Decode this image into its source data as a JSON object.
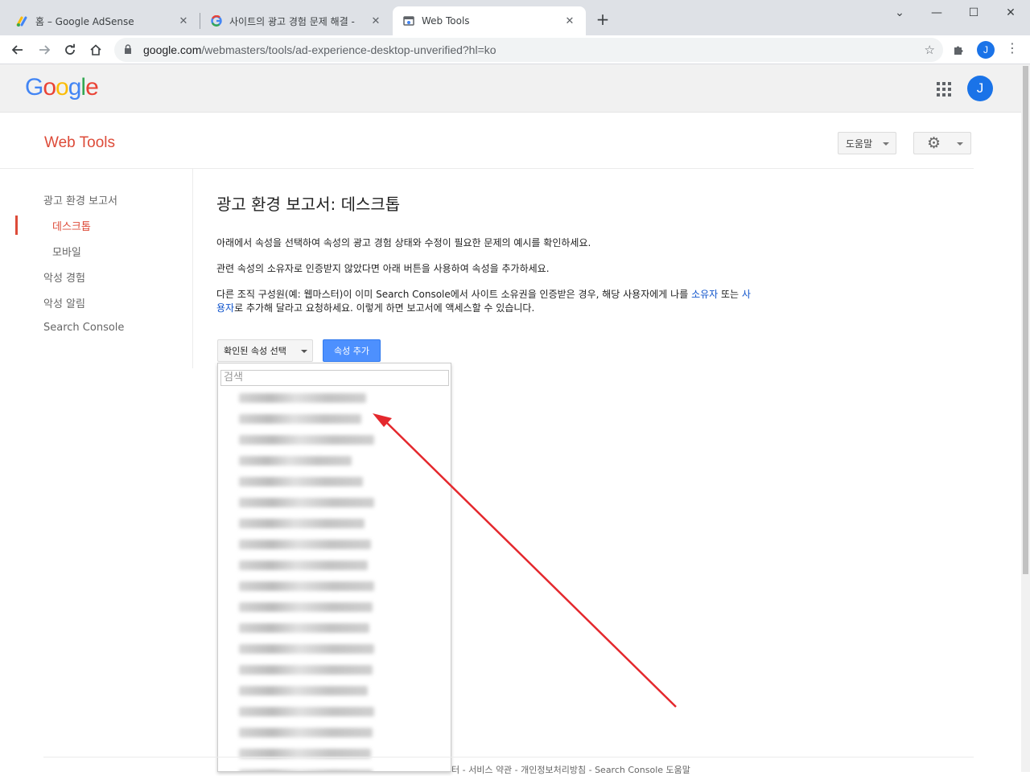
{
  "browser": {
    "tabs": [
      {
        "title": "홈 – Google AdSense",
        "favicon": "adsense-icon"
      },
      {
        "title": "사이트의 광고 경험 문제 해결 -",
        "favicon": "google-g-icon"
      },
      {
        "title": "Web Tools",
        "favicon": "webtools-icon",
        "active": true
      }
    ],
    "new_tab": "+",
    "url_host": "google.com",
    "url_path": "/webmasters/tools/ad-experience-desktop-unverified?hl=ko",
    "profile_initial": "J"
  },
  "header": {
    "logo_letters": [
      {
        "ch": "G",
        "color": "#4285f4"
      },
      {
        "ch": "o",
        "color": "#ea4335"
      },
      {
        "ch": "o",
        "color": "#fbbc05"
      },
      {
        "ch": "g",
        "color": "#4285f4"
      },
      {
        "ch": "l",
        "color": "#34a853"
      },
      {
        "ch": "e",
        "color": "#ea4335"
      }
    ],
    "avatar_initial": "J"
  },
  "webtools": {
    "title": "Web Tools",
    "help_label": "도움말"
  },
  "sidebar": {
    "items": [
      {
        "label": "광고 환경 보고서"
      },
      {
        "label": "데스크톱",
        "active": true
      },
      {
        "label": "모바일"
      },
      {
        "label": "악성 경험"
      },
      {
        "label": "악성 알림"
      },
      {
        "label": "Search Console"
      }
    ]
  },
  "main": {
    "title": "광고 환경 보고서: 데스크톱",
    "para1": "아래에서 속성을 선택하여 속성의 광고 경험 상태와 수정이 필요한 문제의 예시를 확인하세요.",
    "para2": "관련 속성의 소유자로 인증받지 않았다면 아래 버튼을 사용하여 속성을 추가하세요.",
    "para3_line1_a": "다른 조직 구성원(예: 웹마스터)이 이미 Search Console에서 사이트 소유권을 인증받은 경우, 해당 사용자에게 나를 ",
    "para3_link1": "소유자",
    "para3_line1_b": " 또는 ",
    "para3_link2a": "사",
    "para3_link2b": "용자",
    "para3_line2": "로 추가해 달라고 요청하세요. 이렇게 하면 보고서에 액세스할 수 있습니다.",
    "select_label": "확인된 속성 선택",
    "add_button": "속성 추가",
    "search_placeholder": "검색"
  },
  "footer": {
    "text": "터 - 서비스 약관 - 개인정보처리방침 - Search Console 도움말"
  }
}
